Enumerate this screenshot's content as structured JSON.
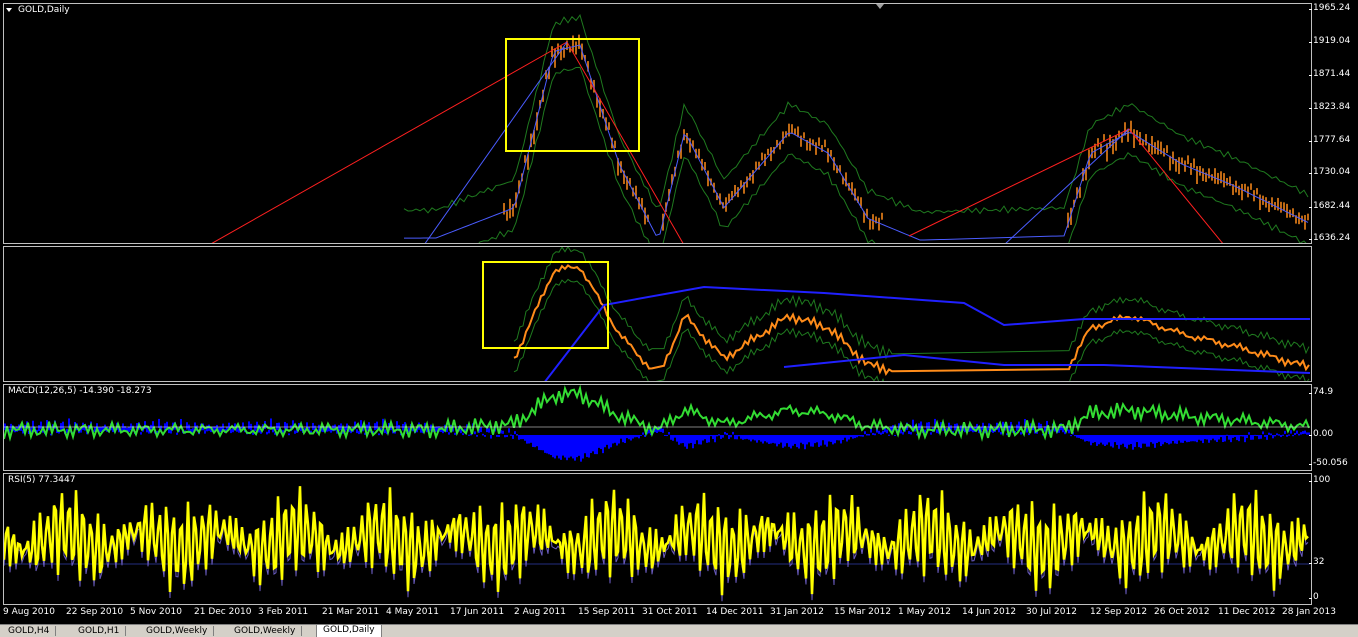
{
  "window": {
    "title": "GOLD,Daily"
  },
  "colors": {
    "background": "#000000",
    "candles": "#ff8c1a",
    "envelope": "#1f7a1f",
    "ma_fast": "#4a5cff",
    "zigzag": "#ff2020",
    "rsi": "#ffff00",
    "macd_hist": "#0000ff",
    "macd_signal": "#33dd33",
    "highlight_box": "#ffff00"
  },
  "main_pane": {
    "label": "GOLD,Daily",
    "price_ticks": [
      "1965.24",
      "1919.04",
      "1871.44",
      "1823.84",
      "1777.64",
      "1730.04",
      "1682.44",
      "1636.24"
    ]
  },
  "indicator_pane": {
    "label": ""
  },
  "macd_pane": {
    "label": "MACD(12,26,5) -14.390 -18.273",
    "scale_ticks": [
      "74.9",
      "0.00",
      "-50.056"
    ]
  },
  "rsi_pane": {
    "label": "RSI(5) 77.3447",
    "scale_ticks": [
      "100",
      "32",
      "0"
    ]
  },
  "time_axis": [
    "9 Aug 2010",
    "22 Sep 2010",
    "5 Nov 2010",
    "21 Dec 2010",
    "3 Feb 2011",
    "21 Mar 2011",
    "4 May 2011",
    "17 Jun 2011",
    "2 Aug 2011",
    "15 Sep 2011",
    "31 Oct 2011",
    "14 Dec 2011",
    "31 Jan 2012",
    "15 Mar 2012",
    "1 May 2012",
    "14 Jun 2012",
    "30 Jul 2012",
    "12 Sep 2012",
    "26 Oct 2012",
    "11 Dec 2012",
    "28 Jan 2013"
  ],
  "tabs": [
    {
      "label": "GOLD,H4",
      "active": false
    },
    {
      "label": "GOLD,H1",
      "active": false
    },
    {
      "label": "GOLD,Weekly",
      "active": false
    },
    {
      "label": "GOLD,Weekly",
      "active": false
    },
    {
      "label": "GOLD,Daily",
      "active": true
    }
  ]
}
